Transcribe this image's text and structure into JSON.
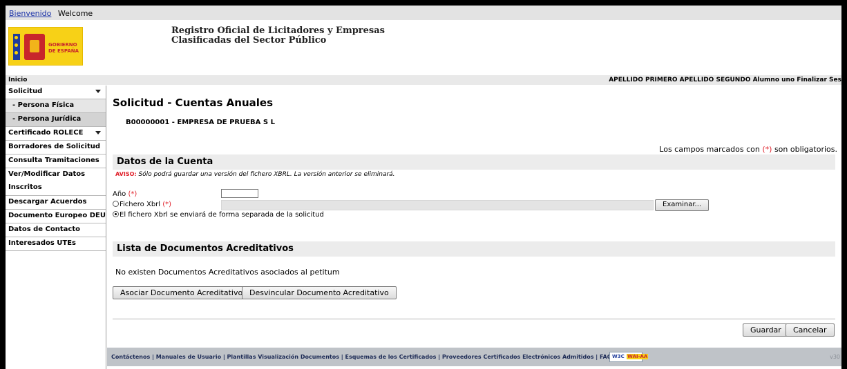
{
  "topbar": {
    "link": "Bienvenido",
    "text": "Welcome"
  },
  "logo": {
    "text_line1": "GOBIERNO",
    "text_line2": "DE ESPAÑA"
  },
  "header": {
    "title_line1": "Registro Oficial de Licitadores y Empresas",
    "title_line2": "Clasificadas del Sector Público"
  },
  "strip": {
    "home": "Inicio",
    "user": "APELLIDO PRIMERO APELLIDO SEGUNDO Alumno uno",
    "logout": "Finalizar Ses"
  },
  "sidebar": {
    "solicitud": "Solicitud",
    "persona_fisica": "- Persona Física",
    "persona_juridica": "- Persona Jurídica",
    "certificado": "Certificado ROLECE",
    "borradores": "Borradores de Solicitud",
    "consulta": "Consulta Tramitaciones",
    "ver_line1": "Ver/Modificar Datos",
    "ver_line2": "Inscritos",
    "descargar": "Descargar Acuerdos",
    "deuc": "Documento Europeo DEUC",
    "contacto": "Datos de Contacto",
    "utes": "Interesados UTEs"
  },
  "main": {
    "title": "Solicitud - Cuentas Anuales",
    "entity": "B00000001 - EMPRESA DE PRUEBA S L",
    "required_prefix": "Los campos marcados con",
    "required_mark": "(*)",
    "required_suffix": "son obligatorios.",
    "section_account": "Datos de la Cuenta",
    "aviso_label": "AVISO:",
    "aviso_text": "Sólo podrá guardar una versión del fichero XBRL. La versión anterior se eliminará.",
    "year_label": "Año",
    "year_value": "",
    "file_label": "Fichero Xbrl",
    "browse": "Examinar...",
    "separate_label": "El fichero Xbrl se enviará de forma separada de la solicitud",
    "section_docs": "Lista de Documentos Acreditativos",
    "no_docs": "No existen Documentos Acreditativos asociados al petitum",
    "associate": "Asociar Documento Acreditativo",
    "unlink": "Desvincular Documento Acreditativo",
    "save": "Guardar",
    "cancel": "Cancelar"
  },
  "footer": {
    "links": "Contáctenos | Manuales de Usuario | Plantillas Visualización Documentos | Esquemas de los Certificados  |  Proveedores Certificados Electrónicos Admitidos | FAQ",
    "badge_a": "W3C",
    "badge_b": "WAI-AA",
    "version": "v30"
  },
  "colors": {
    "required": "#e0202a",
    "sidebar_border": "#9a9a9a",
    "footer": "#bfc3c8"
  }
}
